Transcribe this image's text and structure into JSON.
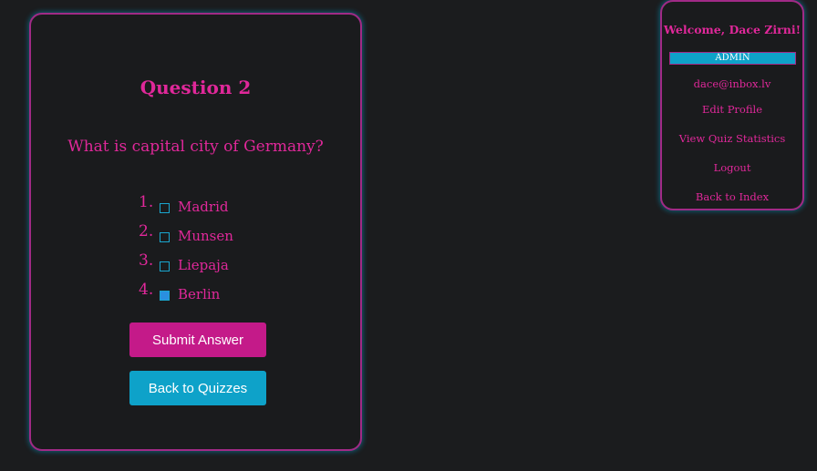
{
  "quiz": {
    "question_title": "Question 2",
    "question_text": "What is capital city of Germany?",
    "options": [
      {
        "number": "1.",
        "label": "Madrid",
        "checked": false
      },
      {
        "number": "2.",
        "label": "Munsen",
        "checked": false
      },
      {
        "number": "3.",
        "label": "Liepaja",
        "checked": false
      },
      {
        "number": "4.",
        "label": "Berlin",
        "checked": true
      }
    ],
    "submit_label": "Submit Answer",
    "back_label": "Back to Quizzes"
  },
  "user_panel": {
    "welcome": "Welcome, Dace Zirni!",
    "role": "ADMIN",
    "email": "dace@inbox.lv",
    "links": {
      "edit_profile": "Edit Profile",
      "view_stats": "View Quiz Statistics",
      "logout": "Logout",
      "back_to_index": "Back to Index"
    }
  },
  "colors": {
    "accent_pink": "#e0289a",
    "accent_cyan": "#0ea2c9",
    "background": "#1b1c1e"
  }
}
